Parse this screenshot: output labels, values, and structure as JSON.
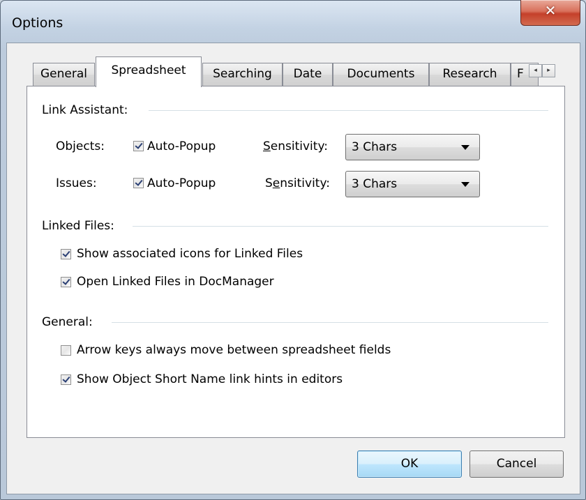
{
  "window": {
    "title": "Options",
    "close_glyph": "✕"
  },
  "tabs": [
    {
      "label": "General",
      "active": false
    },
    {
      "label": "Spreadsheet",
      "active": true
    },
    {
      "label": "Searching",
      "active": false
    },
    {
      "label": "Date",
      "active": false
    },
    {
      "label": "Documents",
      "active": false
    },
    {
      "label": "Research",
      "active": false
    },
    {
      "label": "F",
      "active": false
    }
  ],
  "tab_scroll": {
    "left_glyph": "◂",
    "right_glyph": "▸"
  },
  "link_assistant": {
    "group_label": "Link Assistant:",
    "objects": {
      "label": "Objects:",
      "auto_popup_label": "Auto-Popup",
      "auto_popup_checked": true,
      "sensitivity_label_pre": "",
      "sensitivity_label_key": "S",
      "sensitivity_label_post": "ensitivity:",
      "sensitivity_value": "3 Chars"
    },
    "issues": {
      "label": "Issues:",
      "auto_popup_label": "Auto-Popup",
      "auto_popup_checked": true,
      "sensitivity_label_pre": "S",
      "sensitivity_label_key": "e",
      "sensitivity_label_post": "nsitivity:",
      "sensitivity_value": "3 Chars"
    }
  },
  "linked_files": {
    "group_label": "Linked Files:",
    "options": [
      {
        "label": "Show associated icons for Linked Files",
        "checked": true
      },
      {
        "label": "Open Linked Files in DocManager",
        "checked": true
      }
    ]
  },
  "general": {
    "group_label": "General:",
    "options": [
      {
        "label": "Arrow keys always move between spreadsheet fields",
        "checked": false
      },
      {
        "label": "Show Object Short Name link hints in editors",
        "checked": true
      }
    ]
  },
  "buttons": {
    "ok": "OK",
    "cancel": "Cancel"
  }
}
